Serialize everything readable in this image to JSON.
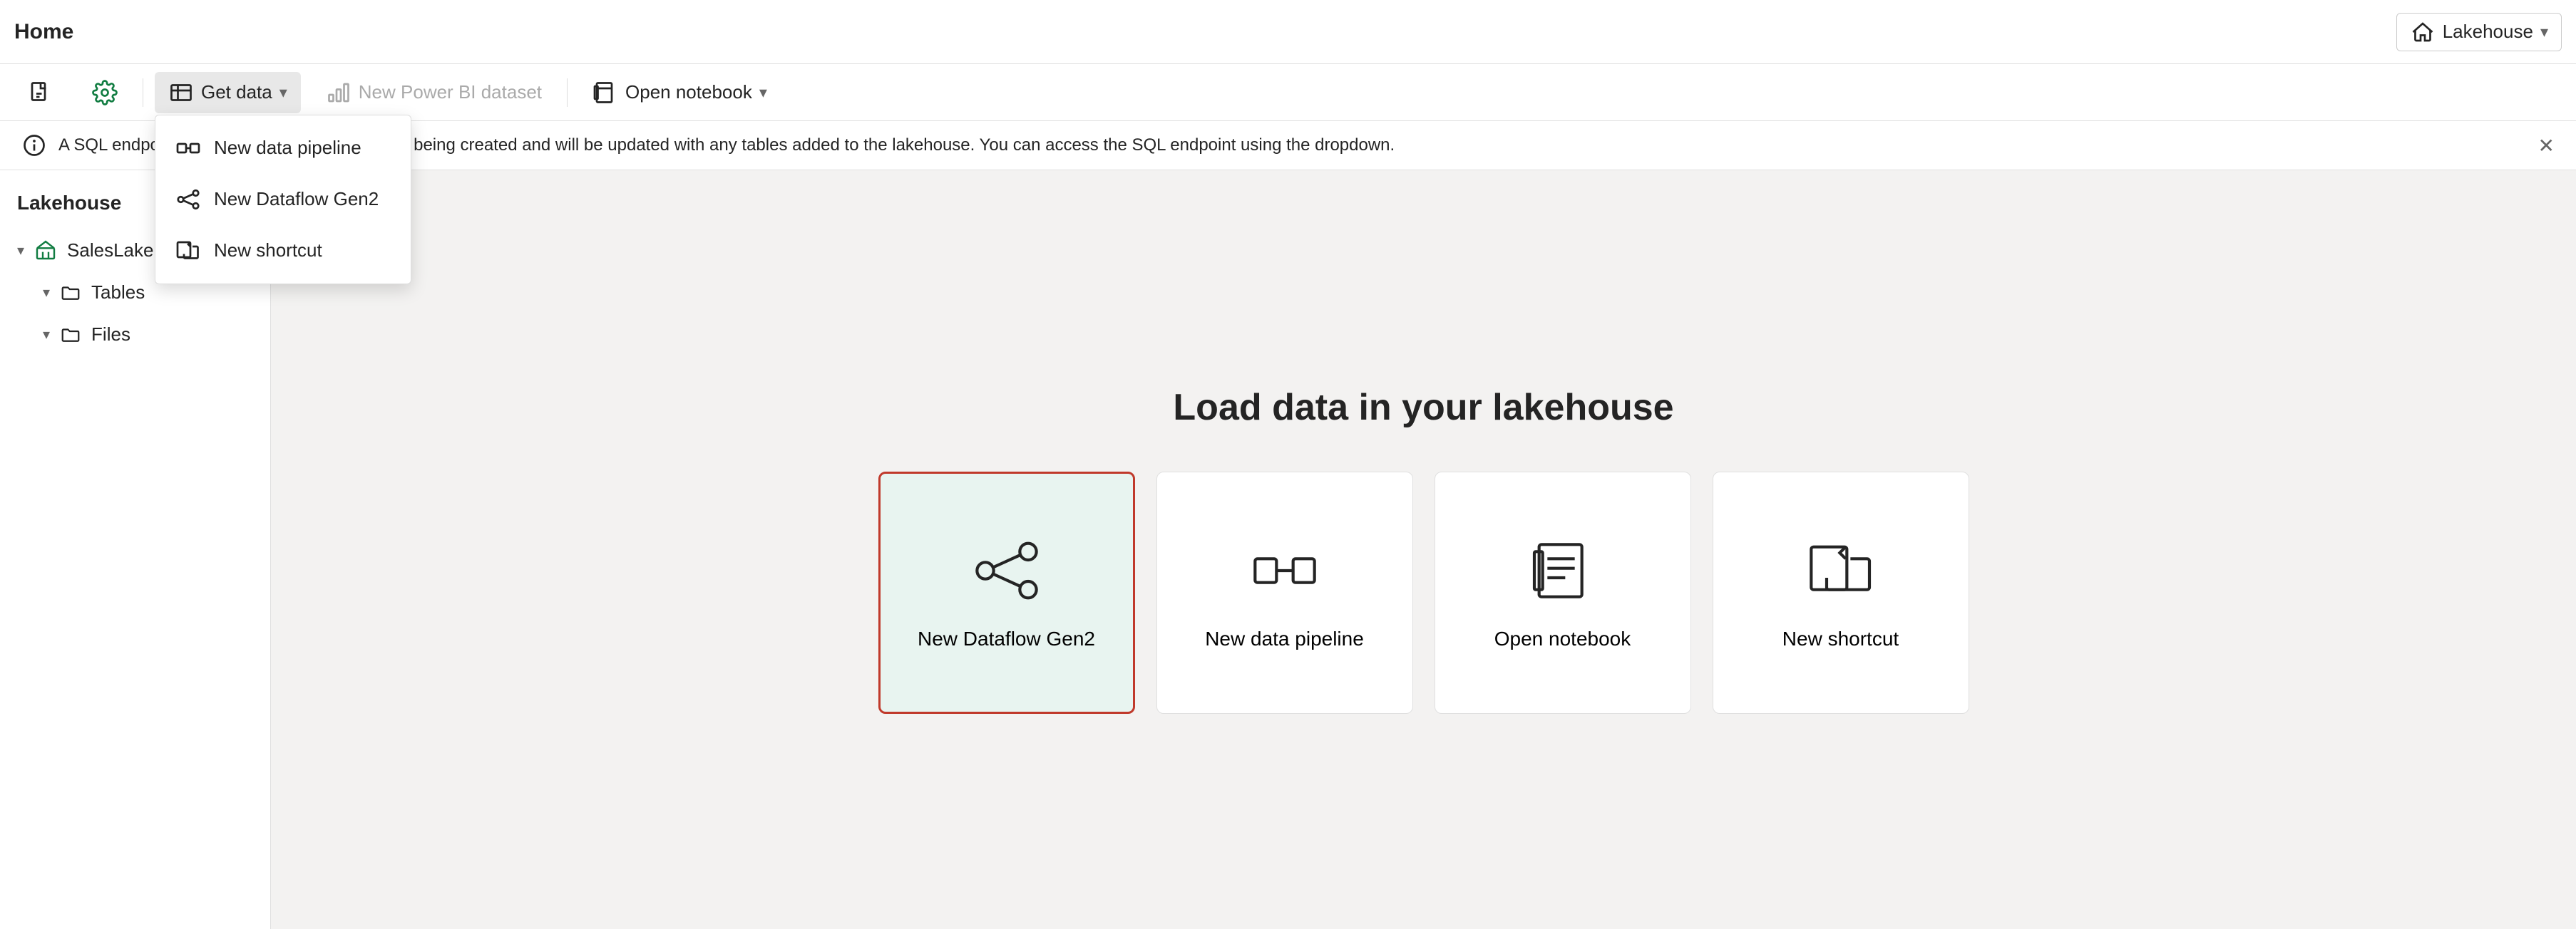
{
  "header": {
    "title": "Home",
    "lakehouse_label": "Lakehouse",
    "chevron_down": "▾",
    "home_icon": "home-icon"
  },
  "toolbar": {
    "new_file_icon": "new-file-icon",
    "settings_icon": "settings-icon",
    "get_data_label": "Get data",
    "get_data_chevron": "▾",
    "new_power_bi_label": "New Power BI dataset",
    "open_notebook_label": "Open notebook",
    "open_notebook_chevron": "▾"
  },
  "dropdown": {
    "items": [
      {
        "id": "new-data-pipeline",
        "label": "New data pipeline",
        "icon": "pipeline-icon"
      },
      {
        "id": "new-dataflow-gen2",
        "label": "New Dataflow Gen2",
        "icon": "dataflow-icon"
      },
      {
        "id": "new-shortcut",
        "label": "New shortcut",
        "icon": "shortcut-icon"
      }
    ]
  },
  "banner": {
    "info_icon": "info-icon",
    "text": "A SQL endpoint default dataset for reporting is being created and will be updated with any tables added to the lakehouse. You can access the SQL endpoint using the dropdown.",
    "close_icon": "close-icon"
  },
  "sidebar": {
    "title": "Lakehouse",
    "items": [
      {
        "id": "sales-lakehouse",
        "label": "SalesLakehouse",
        "level": 0,
        "type": "root",
        "chevron": "▾"
      },
      {
        "id": "tables",
        "label": "Tables",
        "level": 1,
        "type": "folder",
        "chevron": "▾"
      },
      {
        "id": "files",
        "label": "Files",
        "level": 1,
        "type": "folder",
        "chevron": "▾"
      }
    ]
  },
  "main": {
    "title": "Load data in your lakehouse",
    "cards": [
      {
        "id": "new-dataflow-gen2-card",
        "label": "New Dataflow Gen2",
        "icon": "dataflow-card-icon",
        "highlighted": true
      },
      {
        "id": "new-data-pipeline-card",
        "label": "New data pipeline",
        "icon": "pipeline-card-icon",
        "highlighted": false
      },
      {
        "id": "open-notebook-card",
        "label": "Open notebook",
        "icon": "notebook-card-icon",
        "highlighted": false
      },
      {
        "id": "new-shortcut-card",
        "label": "New shortcut",
        "icon": "shortcut-card-icon",
        "highlighted": false
      }
    ]
  },
  "colors": {
    "accent_green": "#107c41",
    "highlight_red": "#c0392b",
    "card_green_bg": "#e8f4f0",
    "text_primary": "#242424",
    "text_muted": "#666666",
    "border": "#e0e0e0"
  }
}
